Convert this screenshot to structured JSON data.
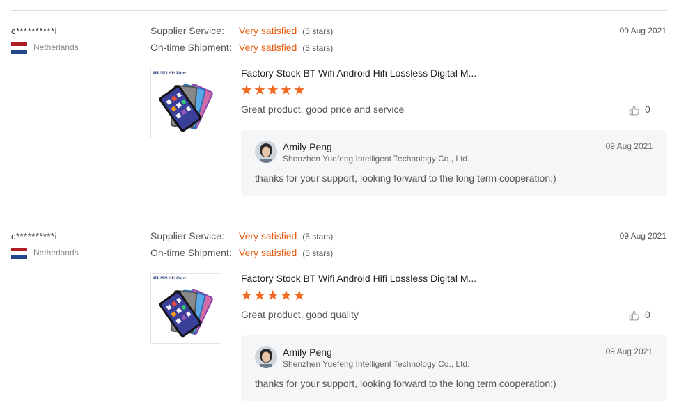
{
  "reviews": [
    {
      "buyer": "c**********i",
      "country": "Netherlands",
      "supplier_service_label": "Supplier Service:",
      "supplier_service_value": "Very satisfied",
      "supplier_service_stars": "(5 stars)",
      "shipment_label": "On-time Shipment:",
      "shipment_value": "Very satisfied",
      "shipment_stars": "(5 stars)",
      "date": "09 Aug 2021",
      "product_title": "Factory Stock BT Wifi Android Hifi Lossless Digital M...",
      "product_image_text": "BEE MP3 MP4 Player",
      "rating": 5,
      "comment": "Great product, good price and service",
      "likes": "0",
      "reply": {
        "name": "Amily Peng",
        "company": "Shenzhen Yuefeng Intelligent Technology Co., Ltd.",
        "date": "09 Aug 2021",
        "text": "thanks for your support, looking forward to the long term cooperation:)"
      }
    },
    {
      "buyer": "c**********i",
      "country": "Netherlands",
      "supplier_service_label": "Supplier Service:",
      "supplier_service_value": "Very satisfied",
      "supplier_service_stars": "(5 stars)",
      "shipment_label": "On-time Shipment:",
      "shipment_value": "Very satisfied",
      "shipment_stars": "(5 stars)",
      "date": "09 Aug 2021",
      "product_title": "Factory Stock BT Wifi Android Hifi Lossless Digital M...",
      "product_image_text": "BEE MP3 MP4 Player",
      "rating": 5,
      "comment": "Great product, good quality",
      "likes": "0",
      "reply": {
        "name": "Amily Peng",
        "company": "Shenzhen Yuefeng Intelligent Technology Co., Ltd.",
        "date": "09 Aug 2021",
        "text": "thanks for your support, looking forward to the long term cooperation:)"
      }
    }
  ],
  "colors": {
    "accent": "#e8590c",
    "star": "#f26a21",
    "reply_bg": "#f5f6f8"
  }
}
